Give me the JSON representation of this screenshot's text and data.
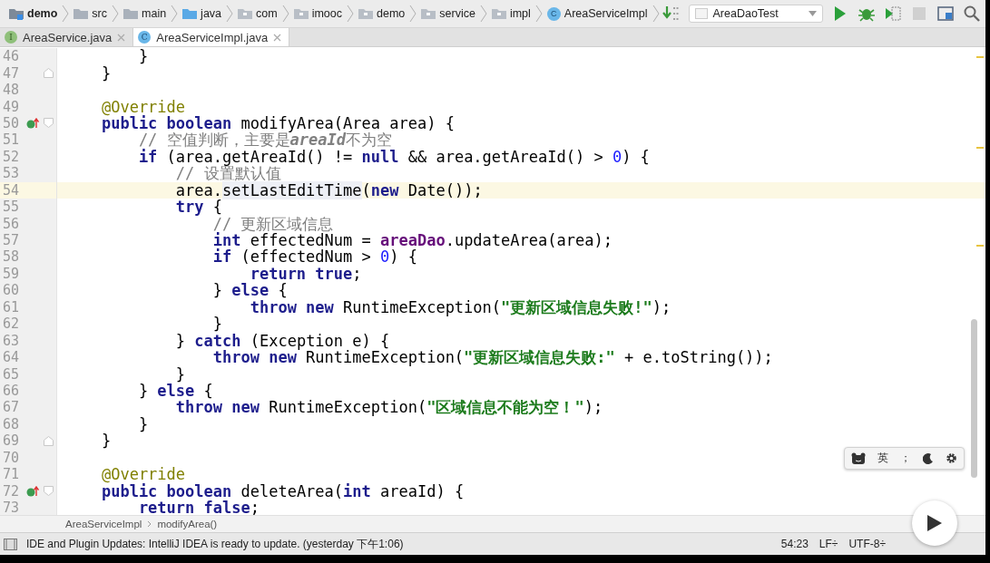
{
  "navbar": {
    "crumbs": [
      {
        "label": "demo",
        "kind": "module"
      },
      {
        "label": "src",
        "kind": "folder"
      },
      {
        "label": "main",
        "kind": "folder"
      },
      {
        "label": "java",
        "kind": "source"
      },
      {
        "label": "com",
        "kind": "package"
      },
      {
        "label": "imooc",
        "kind": "package"
      },
      {
        "label": "demo",
        "kind": "package"
      },
      {
        "label": "service",
        "kind": "package"
      },
      {
        "label": "impl",
        "kind": "package"
      },
      {
        "label": "AreaServiceImpl",
        "kind": "class",
        "icon_letter": "C"
      }
    ],
    "run_config": {
      "value": "AreaDaoTest"
    },
    "actions": [
      {
        "kind": "run",
        "disabled": false
      },
      {
        "kind": "debug",
        "disabled": false
      },
      {
        "kind": "coverage",
        "disabled": false
      },
      {
        "kind": "stop",
        "disabled": true
      },
      {
        "kind": "structure",
        "disabled": false
      },
      {
        "kind": "search",
        "disabled": false
      }
    ]
  },
  "tabs": [
    {
      "label": "AreaService.java",
      "kind": "interface",
      "icon_letter": "I",
      "selected": false
    },
    {
      "label": "AreaServiceImpl.java",
      "kind": "class",
      "icon_letter": "C",
      "selected": true
    }
  ],
  "editor": {
    "lines": [
      {
        "number": "46",
        "tokens": [
          {
            "kind": "p",
            "text": "        }"
          }
        ]
      },
      {
        "number": "47",
        "fold": {
          "kind": "end"
        },
        "tokens": [
          {
            "kind": "p",
            "text": "    }"
          }
        ]
      },
      {
        "number": "48"
      },
      {
        "number": "49",
        "tokens": [
          {
            "kind": "ann",
            "text": "    @Override"
          }
        ]
      },
      {
        "number": "50",
        "gutter_icon": true,
        "fold": {
          "kind": "start"
        },
        "tokens": [
          {
            "kind": "kw",
            "text": "    public boolean"
          },
          {
            "kind": "p",
            "text": " modifyArea(Area area) {"
          }
        ]
      },
      {
        "number": "51",
        "tokens": [
          {
            "kind": "c",
            "text": "        // 空值判断，主要是"
          },
          {
            "kind": "ci",
            "text": "areaId"
          },
          {
            "kind": "c",
            "text": "不为空"
          }
        ]
      },
      {
        "number": "52",
        "tokens": [
          {
            "kind": "kw",
            "text": "        if"
          },
          {
            "kind": "p",
            "text": " (area.getAreaId() != "
          },
          {
            "kind": "kw",
            "text": "null"
          },
          {
            "kind": "p",
            "text": " && area.getAreaId() > "
          },
          {
            "kind": "num",
            "text": "0"
          },
          {
            "kind": "p",
            "text": ") {"
          }
        ]
      },
      {
        "number": "53",
        "tokens": [
          {
            "kind": "c",
            "text": "            // 设置默认值"
          }
        ]
      },
      {
        "number": "54",
        "current": true,
        "tokens": [
          {
            "kind": "p",
            "text": "            area."
          },
          {
            "kind": "m",
            "text": "setLastEditTime"
          },
          {
            "kind": "p",
            "text": "("
          },
          {
            "kind": "kw",
            "text": "new"
          },
          {
            "kind": "p",
            "text": " Date());"
          }
        ]
      },
      {
        "number": "55",
        "tokens": [
          {
            "kind": "kw",
            "text": "            try"
          },
          {
            "kind": "p",
            "text": " {"
          }
        ]
      },
      {
        "number": "56",
        "tokens": [
          {
            "kind": "c",
            "text": "                // 更新区域信息"
          }
        ]
      },
      {
        "number": "57",
        "tokens": [
          {
            "kind": "kw",
            "text": "                int"
          },
          {
            "kind": "p",
            "text": " effectedNum = "
          },
          {
            "kind": "f",
            "text": "areaDao"
          },
          {
            "kind": "p",
            "text": ".updateArea(area);"
          }
        ]
      },
      {
        "number": "58",
        "tokens": [
          {
            "kind": "kw",
            "text": "                if"
          },
          {
            "kind": "p",
            "text": " (effectedNum > "
          },
          {
            "kind": "num",
            "text": "0"
          },
          {
            "kind": "p",
            "text": ") {"
          }
        ]
      },
      {
        "number": "59",
        "tokens": [
          {
            "kind": "kw",
            "text": "                    return true"
          },
          {
            "kind": "p",
            "text": ";"
          }
        ]
      },
      {
        "number": "60",
        "tokens": [
          {
            "kind": "p",
            "text": "                } "
          },
          {
            "kind": "kw",
            "text": "else"
          },
          {
            "kind": "p",
            "text": " {"
          }
        ]
      },
      {
        "number": "61",
        "tokens": [
          {
            "kind": "kw",
            "text": "                    throw new"
          },
          {
            "kind": "p",
            "text": " RuntimeException("
          },
          {
            "kind": "s",
            "text": "\"更新区域信息失败!\""
          },
          {
            "kind": "p",
            "text": ");"
          }
        ]
      },
      {
        "number": "62",
        "tokens": [
          {
            "kind": "p",
            "text": "                }"
          }
        ]
      },
      {
        "number": "63",
        "tokens": [
          {
            "kind": "p",
            "text": "            } "
          },
          {
            "kind": "kw",
            "text": "catch"
          },
          {
            "kind": "p",
            "text": " (Exception e) {"
          }
        ]
      },
      {
        "number": "64",
        "tokens": [
          {
            "kind": "kw",
            "text": "                throw new"
          },
          {
            "kind": "p",
            "text": " RuntimeException("
          },
          {
            "kind": "s",
            "text": "\"更新区域信息失败:\""
          },
          {
            "kind": "p",
            "text": " + e.toString());"
          }
        ]
      },
      {
        "number": "65",
        "tokens": [
          {
            "kind": "p",
            "text": "            }"
          }
        ]
      },
      {
        "number": "66",
        "tokens": [
          {
            "kind": "p",
            "text": "        } "
          },
          {
            "kind": "kw",
            "text": "else"
          },
          {
            "kind": "p",
            "text": " {"
          }
        ]
      },
      {
        "number": "67",
        "tokens": [
          {
            "kind": "kw",
            "text": "            throw new"
          },
          {
            "kind": "p",
            "text": " RuntimeException("
          },
          {
            "kind": "s",
            "text": "\"区域信息不能为空！\""
          },
          {
            "kind": "p",
            "text": ");"
          }
        ]
      },
      {
        "number": "68",
        "tokens": [
          {
            "kind": "p",
            "text": "        }"
          }
        ]
      },
      {
        "number": "69",
        "fold": {
          "kind": "end"
        },
        "tokens": [
          {
            "kind": "p",
            "text": "    }"
          }
        ]
      },
      {
        "number": "70"
      },
      {
        "number": "71",
        "tokens": [
          {
            "kind": "ann",
            "text": "    @Override"
          }
        ]
      },
      {
        "number": "72",
        "gutter_icon": true,
        "fold": {
          "kind": "start"
        },
        "tokens": [
          {
            "kind": "kw",
            "text": "    public boolean"
          },
          {
            "kind": "p",
            "text": " deleteArea("
          },
          {
            "kind": "kw",
            "text": "int"
          },
          {
            "kind": "p",
            "text": " areaId) {"
          }
        ]
      },
      {
        "number": "73",
        "tokens": [
          {
            "kind": "kw",
            "text": "        return false"
          },
          {
            "kind": "p",
            "text": ";"
          }
        ]
      }
    ]
  },
  "ime_bar": {
    "mode": "英",
    "punctuation": "；"
  },
  "breadcrumb": [
    "AreaServiceImpl",
    "modifyArea()"
  ],
  "status_bar": {
    "message": "IDE and Plugin Updates: IntelliJ IDEA is ready to update. (yesterday 下午1:06)",
    "position": "54:23",
    "line_separator": "LF÷",
    "encoding": "UTF-8÷"
  }
}
